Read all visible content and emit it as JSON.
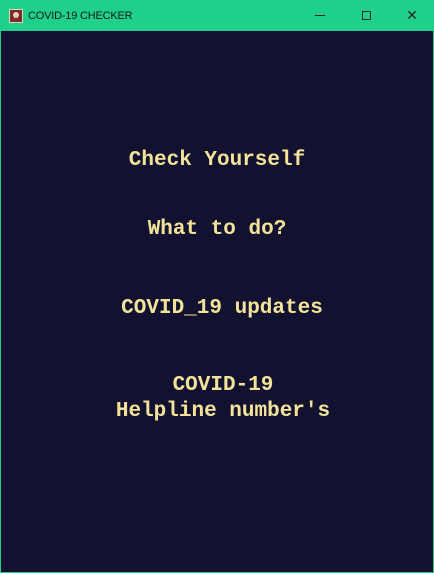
{
  "window": {
    "title": "COVID-19 CHECKER",
    "controls": {
      "minimize": "—",
      "maximize": "☐",
      "close": "✕"
    },
    "colors": {
      "titlebar": "#1fd08a",
      "background": "#121230",
      "text": "#f3e39a"
    }
  },
  "menu": {
    "check_yourself": "Check Yourself",
    "what_to_do": "What to do?",
    "updates": "COVID_19 updates",
    "helpline_line1": "COVID-19",
    "helpline_line2": "Helpline number's"
  }
}
